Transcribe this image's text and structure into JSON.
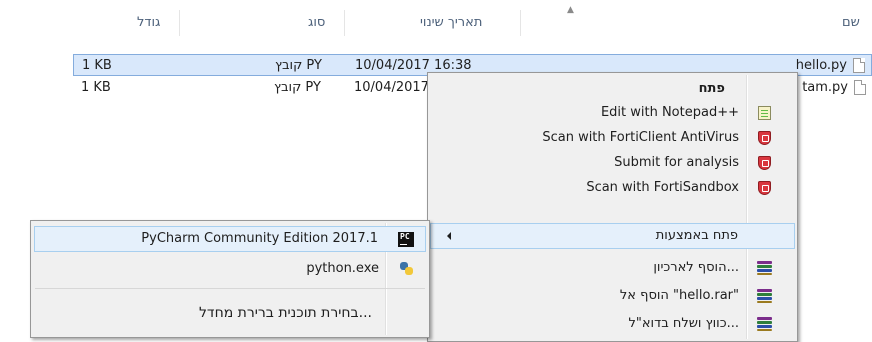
{
  "columns": {
    "name": "שם",
    "date": "תאריך שינוי",
    "type": "סוג",
    "size": "גודל"
  },
  "files": [
    {
      "name": "hello.py",
      "date": "10/04/2017 16:38",
      "type": "קובץ PY",
      "size": "1 KB",
      "selected": true
    },
    {
      "name": "tam.py",
      "date": "10/04/2017 16:38",
      "type": "קובץ PY",
      "size": "1 KB",
      "selected": false
    }
  ],
  "context_menu": {
    "items": [
      {
        "label": "פתח",
        "bold": true,
        "icon": ""
      },
      {
        "label": "Edit with Notepad++",
        "icon": "notepad-plus-plus-icon"
      },
      {
        "label": "Scan with FortiClient AntiVirus",
        "icon": "forticlient-shield-icon"
      },
      {
        "label": "Submit for analysis",
        "icon": "forticlient-shield-icon"
      },
      {
        "label": "Scan with FortiSandbox",
        "icon": "forticlient-shield-icon"
      },
      {
        "label": "פתח באמצעות",
        "icon": "",
        "submenu": true
      },
      {
        "label": "הוסף לארכיון...",
        "icon": "winrar-books-icon"
      },
      {
        "label": "הוסף אל \"hello.rar\"",
        "icon": "winrar-books-icon"
      },
      {
        "label": "כווץ ושלח בדוא\"ל...",
        "icon": "winrar-books-icon"
      }
    ]
  },
  "open_with_menu": {
    "items": [
      {
        "label": "PyCharm Community Edition 2017.1",
        "icon": "pycharm-icon"
      },
      {
        "label": "python.exe",
        "icon": "python-icon"
      },
      {
        "label": "בחירת תוכנית ברירת מחדל...",
        "icon": ""
      }
    ]
  },
  "colors": {
    "selection_bg": "#d9e8fb",
    "selection_border": "#84acdd",
    "menu_bg": "#f0f0f0",
    "menu_highlight": "#e5f0fb",
    "header_text": "#4c607a",
    "forti_red": "#d9363e"
  }
}
